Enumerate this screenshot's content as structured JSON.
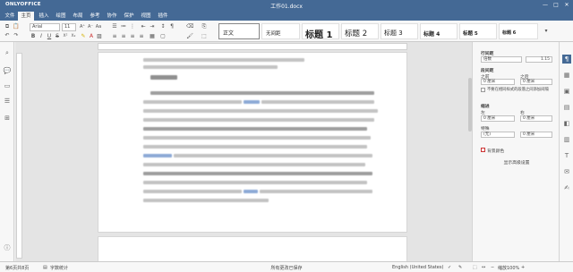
{
  "app": {
    "logo": "ONLYOFFICE",
    "title": "工作01.docx"
  },
  "window_controls": [
    "—",
    "□",
    "✕"
  ],
  "menu": {
    "tabs": [
      "文件",
      "主页",
      "插入",
      "绘图",
      "布局",
      "参考",
      "协作",
      "保护",
      "视图",
      "插件"
    ],
    "active_index": 1
  },
  "toolbar": {
    "font_name": "Arial",
    "font_size": "11",
    "size_up": "A⁺",
    "size_down": "A⁻",
    "case": "Aa",
    "bold": "B",
    "italic": "I",
    "underline": "U",
    "strike": "S",
    "superscript": "X²",
    "subscript": "X₂",
    "pilcrow": "¶"
  },
  "styles": [
    {
      "label": "正文",
      "font_px": "6px"
    },
    {
      "label": "无间距",
      "font_px": "5.5px"
    },
    {
      "label": "标题 1",
      "font_px": "10px"
    },
    {
      "label": "标题 2",
      "font_px": "8.5px"
    },
    {
      "label": "标题 3",
      "font_px": "7px"
    },
    {
      "label": "标题 4",
      "font_px": "6px"
    },
    {
      "label": "标题 5",
      "font_px": "5.5px"
    },
    {
      "label": "标题 6",
      "font_px": "5px"
    }
  ],
  "styles_more": "▾",
  "document": {
    "page_icon_hint": "page"
  },
  "right_panel": {
    "section_line_spacing": "行间距",
    "spacing_type": "倍数",
    "spacing_value": "1.15",
    "section_paragraph_spacing": "段间距",
    "before_label": "之前",
    "after_label": "之后",
    "before_value": "0 厘米",
    "after_value": "0 厘米",
    "no_space_same_style": "不要在相同样式的段落之间添加间隔",
    "section_indent": "缩进",
    "left_label": "左",
    "right_label": "右",
    "left_value": "0 厘米",
    "right_value": "0 厘米",
    "special_label": "特殊",
    "special_value": "(无)",
    "special_amount": "0 厘米",
    "bg_color_label": "背景颜色",
    "advanced_label": "显示高级设置"
  },
  "status": {
    "page_info": "第6页共8页",
    "word_count": "字数统计",
    "save_state": "所有更改已保存",
    "language": "English (United States)",
    "zoom": "缩放100%"
  },
  "colors": {
    "brand": "#446995",
    "toolbar": "#f7f7f7",
    "canvas": "#e4e4e4",
    "link_blue": "#3b6fc4"
  }
}
